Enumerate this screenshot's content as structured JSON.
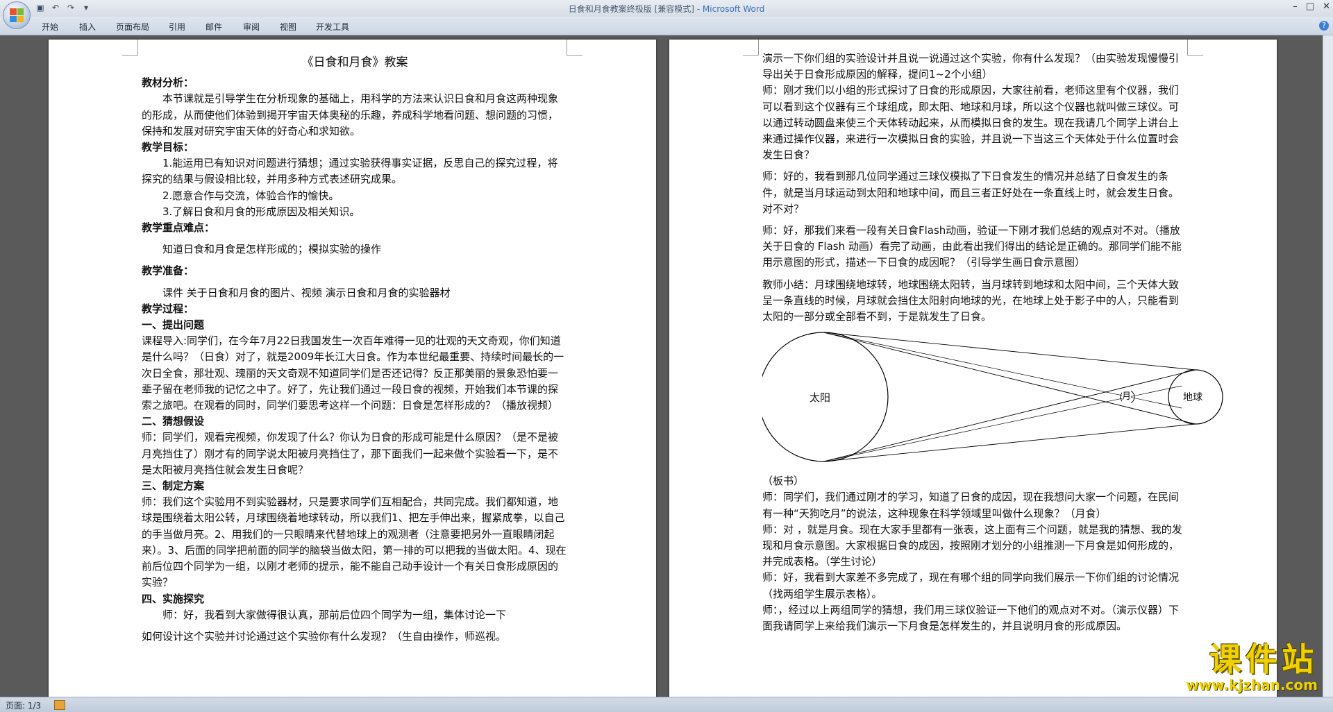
{
  "window": {
    "doc_title": "日食和月食教案终极版 [兼容模式] - ",
    "app_name": "Microsoft Word",
    "qat": [
      "save-icon",
      "undo-icon",
      "redo-icon",
      "customize-icon"
    ]
  },
  "ribbon": {
    "tabs": [
      "开始",
      "插入",
      "页面布局",
      "引用",
      "邮件",
      "审阅",
      "视图",
      "开发工具"
    ]
  },
  "page1": {
    "title": "《日食和月食》教案",
    "lines": [
      {
        "t": "教材分析：",
        "c": "h"
      },
      {
        "t": "本节课就是引导学生在分析现象的基础上，用科学的方法来认识日食和月食这两种现象的形成，从而使他们体验到揭开宇宙天体奥秘的乐趣，养成科学地看问题、想问题的习惯，保持和发展对研究宇宙天体的好奇心和求知欲。",
        "c": "ind"
      },
      {
        "t": "教学目标：",
        "c": "h"
      },
      {
        "t": "1.能运用已有知识对问题进行猜想；通过实验获得事实证据，反思自己的探究过程，将探究的结果与假设相比较，并用多种方式表述研究成果。",
        "c": "ind"
      },
      {
        "t": "2.愿意合作与交流，体验合作的愉快。",
        "c": "ind"
      },
      {
        "t": "3.了解日食和月食的形成原因及相关知识。",
        "c": "ind"
      },
      {
        "t": "教学重点难点：",
        "c": "h"
      },
      {
        "t": "",
        "c": "gap"
      },
      {
        "t": "知道日食和月食是怎样形成的；模拟实验的操作",
        "c": "ind"
      },
      {
        "t": "",
        "c": "gap"
      },
      {
        "t": "教学准备：",
        "c": "h"
      },
      {
        "t": "",
        "c": "gap"
      },
      {
        "t": "课件 关于日食和月食的图片、视频 演示日食和月食的实验器材",
        "c": "ind"
      },
      {
        "t": "教学过程：",
        "c": "h"
      },
      {
        "t": "一、提出问题",
        "c": "h"
      },
      {
        "t": "课程导入:同学们，在今年7月22日我国发生一次百年难得一见的壮观的天文奇观，你们知道是什么吗？（日食）对了，就是2009年长江大日食。作为本世纪最重要、持续时间最长的一次日全食，那壮观、瑰丽的天文奇观不知道同学们是否还记得？反正那美丽的景象恐怕要一辈子留在老师我的记忆之中了。好了，先让我们通过一段日食的视频，开始我们本节课的探索之旅吧。在观看的同时，同学们要思考这样一个问题：日食是怎样形成的？（播放视频）",
        "c": ""
      },
      {
        "t": "二、猜想假设",
        "c": "h"
      },
      {
        "t": "师：同学们，观看完视频，你发现了什么？你认为日食的形成可能是什么原因？（是不是被月亮挡住了）刚才有的同学说太阳被月亮挡住了，那下面我们一起来做个实验看一下，是不是太阳被月亮挡住就会发生日食呢？",
        "c": ""
      },
      {
        "t": "三、制定方案",
        "c": "h"
      },
      {
        "t": "师：我们这个实验用不到实验器材，只是要求同学们互相配合，共同完成。我们都知道，地球是围绕着太阳公转，月球围绕着地球转动，所以我们1、把左手伸出来，握紧成拳，以自己的手当做月亮。2、用我们的一只眼睛来代替地球上的观测者（注意要把另外一直眼睛闭起来）。3、后面的同学把前面的同学的脑袋当做太阳，第一排的可以把我的当做太阳。4、现在前后位四个同学为一组，以刚才老师的提示，能不能自己动手设计一个有关日食形成原因的实验？",
        "c": ""
      },
      {
        "t": "四、实施探究",
        "c": "h"
      },
      {
        "t": "师：好，我看到大家做得很认真，那前后位四个同学为一组，集体讨论一下",
        "c": "ind"
      },
      {
        "t": "",
        "c": "gap"
      },
      {
        "t": "如何设计这个实验并讨论通过这个实验你有什么发现？（生自由操作，师巡视。",
        "c": ""
      }
    ]
  },
  "page2": {
    "lines_before": [
      {
        "t": "演示一下你们组的实验设计并且说一说通过这个实验，你有什么发现？（由实验发现慢慢引导出关于日食形成原因的解释，提问1~2个小组）",
        "c": ""
      },
      {
        "t": "师：刚才我们以小组的形式探讨了日食的形成原因，大家往前看，老师这里有个仪器，我们可以看到这个仪器有三个球组成，即太阳、地球和月球，所以这个仪器也就叫做三球仪。可以通过转动圆盘来使三个天体转动起来，从而模拟日食的发生。现在我请几个同学上讲台上来通过操作仪器，来进行一次模拟日食的实验，并且说一下当这三个天体处于什么位置时会发生日食？",
        "c": ""
      },
      {
        "t": "",
        "c": "gap"
      },
      {
        "t": "师：好的，我看到那几位同学通过三球仪模拟了下日食发生的情况并总结了日食发生的条件，就是当月球运动到太阳和地球中间，而且三者正好处在一条直线上时，就会发生日食。对不对？",
        "c": ""
      },
      {
        "t": "",
        "c": "gap"
      },
      {
        "t": "师：好，那我们来看一段有关日食Flash动画，验证一下刚才我们总结的观点对不对。（播放关于日食的 Flash 动画）看完了动画，由此看出我们得出的结论是正确的。那同学们能不能用示意图的形式，描述一下日食的成因呢？（引导学生画日食示意图）",
        "c": ""
      },
      {
        "t": "",
        "c": "gap"
      },
      {
        "t": "教师小结：月球围绕地球转，地球围绕太阳转，当月球转到地球和太阳中间，三个天体大致呈一条直线的时候，月球就会挡住太阳射向地球的光，在地球上处于影子中的人，只能看到太阳的一部分或全部看不到，于是就发生了日食。",
        "c": ""
      }
    ],
    "diagram": {
      "sun": "太阳",
      "moon": "月",
      "earth": "地球"
    },
    "lines_after": [
      {
        "t": "（板书）",
        "c": ""
      },
      {
        "t": "师：同学们，我们通过刚才的学习，知道了日食的成因，现在我想问大家一个问题，在民间有一种“天狗吃月”的说法，这种现象在科学领域里叫做什么现象？（月食）",
        "c": ""
      },
      {
        "t": "师：对 ，就是月食。现在大家手里都有一张表，这上面有三个问题，就是我的猜想、我的发现和月食示意图。大家根据日食的成因，按照刚才划分的小组推测一下月食是如何形成的，并完成表格。（学生讨论）",
        "c": ""
      },
      {
        "t": "师：好，我看到大家差不多完成了，现在有哪个组的同学向我们展示一下你们组的讨论情况（找两组学生展示表格）。",
        "c": ""
      },
      {
        "t": "师：，经过以上两组同学的猜想，我们用三球仪验证一下他们的观点对不对。（演示仪器）下面我请同学上来给我们演示一下月食是怎样发生的，并且说明月食的形成原因。",
        "c": ""
      }
    ]
  },
  "statusbar": {
    "page": "页面: 1/3"
  },
  "watermark": {
    "title": "课件站",
    "url": "www.kjzhan.com"
  }
}
